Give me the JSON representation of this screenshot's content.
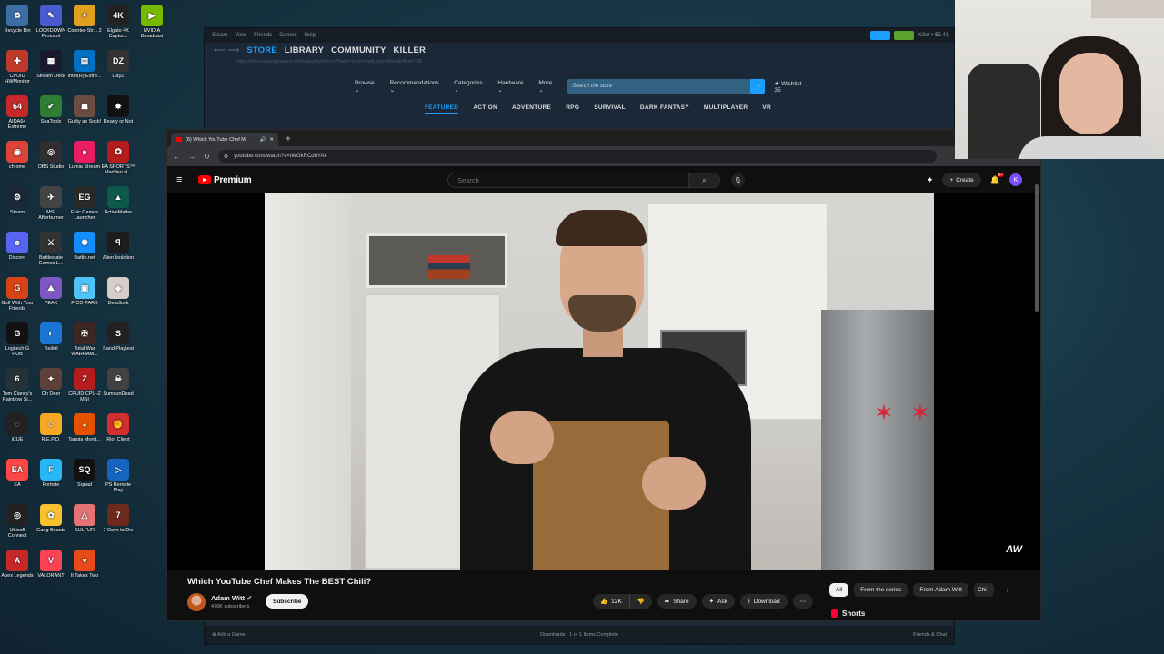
{
  "desktop": {
    "icons": [
      {
        "label": "Recycle Bin",
        "icon": "recycle-bin-icon",
        "color": "#3b6ea5",
        "glyph": "♻"
      },
      {
        "label": "LOCKDOWN Protocol",
        "icon": "lockdown-protocol-icon",
        "color": "#4a5bd0",
        "glyph": "✎"
      },
      {
        "label": "Counter-Str... 2",
        "icon": "counter-strike-icon",
        "color": "#e0a020",
        "glyph": "✦"
      },
      {
        "label": "Elgato 4K Captur...",
        "icon": "elgato-icon",
        "color": "#222",
        "glyph": "4K"
      },
      {
        "label": "NVIDIA Broadcast",
        "icon": "nvidia-broadcast-icon",
        "color": "#76b900",
        "glyph": "▶"
      },
      {
        "label": "CPUID HWMonitor",
        "icon": "hwmonitor-icon",
        "color": "#c0392b",
        "glyph": "✚"
      },
      {
        "label": "Stream Deck",
        "icon": "stream-deck-icon",
        "color": "#1a1a2e",
        "glyph": "▦"
      },
      {
        "label": "Intel(R) Extre...",
        "icon": "intel-xtu-icon",
        "color": "#0071c5",
        "glyph": "▤"
      },
      {
        "label": "DayZ",
        "icon": "dayz-icon",
        "color": "#333",
        "glyph": "DZ"
      },
      {
        "label": "AIDA64 Extreme",
        "icon": "aida64-icon",
        "color": "#c62828",
        "glyph": "64"
      },
      {
        "label": "SeaTools",
        "icon": "seatools-icon",
        "color": "#2e7d32",
        "glyph": "✔"
      },
      {
        "label": "Guilty as Sock!",
        "icon": "guilty-as-sock-icon",
        "color": "#6d4c41",
        "glyph": "☗"
      },
      {
        "label": "Ready or Not",
        "icon": "ready-or-not-icon",
        "color": "#111",
        "glyph": "✸"
      },
      {
        "label": "chrome",
        "icon": "chrome-icon",
        "color": "#db4437",
        "glyph": "◉"
      },
      {
        "label": "OBS Studio",
        "icon": "obs-icon",
        "color": "#302e31",
        "glyph": "◎"
      },
      {
        "label": "Lumia Stream",
        "icon": "lumia-stream-icon",
        "color": "#e91e63",
        "glyph": "●"
      },
      {
        "label": "EA SPORTS™ Madden N...",
        "icon": "madden-icon",
        "color": "#b71c1c",
        "glyph": "✪"
      },
      {
        "label": "Steam",
        "icon": "steam-icon",
        "color": "#1b2838",
        "glyph": "⚙"
      },
      {
        "label": "MSI Afterburner",
        "icon": "msi-afterburner-icon",
        "color": "#444",
        "glyph": "✈"
      },
      {
        "label": "Epic Games Launcher",
        "icon": "epic-games-icon",
        "color": "#2a2a2a",
        "glyph": "EG"
      },
      {
        "label": "ActiveMatter",
        "icon": "active-matter-icon",
        "color": "#0e5a4a",
        "glyph": "▲"
      },
      {
        "label": "Discord",
        "icon": "discord-icon",
        "color": "#5865f2",
        "glyph": "☻"
      },
      {
        "label": "Battlestate Games L...",
        "icon": "battlestate-icon",
        "color": "#333",
        "glyph": "⚔"
      },
      {
        "label": "Battle.net",
        "icon": "battlenet-icon",
        "color": "#148eff",
        "glyph": "✺"
      },
      {
        "label": "Alien Isolation",
        "icon": "alien-isolation-icon",
        "color": "#1c1c1c",
        "glyph": "ꟼ"
      },
      {
        "label": "Golf With Your Friends",
        "icon": "golf-with-friends-icon",
        "color": "#d84315",
        "glyph": "G"
      },
      {
        "label": "PEAK",
        "icon": "peak-icon",
        "color": "#7e57c2",
        "glyph": "⛰"
      },
      {
        "label": "PICO PARK",
        "icon": "pico-park-icon",
        "color": "#4fc3f7",
        "glyph": "▣"
      },
      {
        "label": "Deadlock",
        "icon": "deadlock-icon",
        "color": "#d7ccc8",
        "glyph": "◈"
      },
      {
        "label": "Logitech G HUB",
        "icon": "logitech-ghub-icon",
        "color": "#111",
        "glyph": "G"
      },
      {
        "label": "Toolkit",
        "icon": "toolkit-icon",
        "color": "#1976d2",
        "glyph": "◐"
      },
      {
        "label": "Total War WARHAM...",
        "icon": "total-war-icon",
        "color": "#3e2723",
        "glyph": "✠"
      },
      {
        "label": "Sand Playtest",
        "icon": "sand-playtest-icon",
        "color": "#222",
        "glyph": "S"
      },
      {
        "label": "Tom Clancy's Rainbow Si...",
        "icon": "rainbow-six-icon",
        "color": "#263238",
        "glyph": "6"
      },
      {
        "label": "Oh Deer",
        "icon": "oh-deer-icon",
        "color": "#5d4037",
        "glyph": "✦"
      },
      {
        "label": "CPUID CPU-Z MSI",
        "icon": "cpu-z-icon",
        "color": "#b71c1c",
        "glyph": "Z"
      },
      {
        "label": "SumsunDead",
        "icon": "sumsundead-icon",
        "color": "#424242",
        "glyph": "☠"
      },
      {
        "label": "iCUE",
        "icon": "icue-icon",
        "color": "#222",
        "glyph": "◌"
      },
      {
        "label": "R.E.P.O.",
        "icon": "repo-icon",
        "color": "#f9a825",
        "glyph": "☺"
      },
      {
        "label": "Tangia Monit...",
        "icon": "tangia-icon",
        "color": "#e65100",
        "glyph": "◕"
      },
      {
        "label": "Riot Client",
        "icon": "riot-client-icon",
        "color": "#d32f2f",
        "glyph": "✊"
      },
      {
        "label": "EA",
        "icon": "ea-icon",
        "color": "#ff4747",
        "glyph": "EA"
      },
      {
        "label": "Fortnite",
        "icon": "fortnite-icon",
        "color": "#29b6f6",
        "glyph": "F"
      },
      {
        "label": "Squad",
        "icon": "squad-icon",
        "color": "#111",
        "glyph": "SQ"
      },
      {
        "label": "PS Remote Play",
        "icon": "ps-remote-play-icon",
        "color": "#1565c0",
        "glyph": "▷"
      },
      {
        "label": "Ubisoft Connect",
        "icon": "ubisoft-connect-icon",
        "color": "#222",
        "glyph": "◎"
      },
      {
        "label": "Gang Beasts",
        "icon": "gang-beasts-icon",
        "color": "#fbc02d",
        "glyph": "✿"
      },
      {
        "label": "SULFUR",
        "icon": "sulfur-icon",
        "color": "#e57373",
        "glyph": "△"
      },
      {
        "label": "7 Days to Die",
        "icon": "7-days-to-die-icon",
        "color": "#6d2a1a",
        "glyph": "7"
      },
      {
        "label": "Apex Legends",
        "icon": "apex-legends-icon",
        "color": "#c62828",
        "glyph": "A"
      },
      {
        "label": "VALORANT",
        "icon": "valorant-icon",
        "color": "#fa4454",
        "glyph": "V"
      },
      {
        "label": "It Takes Two",
        "icon": "it-takes-two-icon",
        "color": "#e64a19",
        "glyph": "♥"
      }
    ]
  },
  "steam": {
    "menu": [
      "Steam",
      "View",
      "Friends",
      "Games",
      "Help"
    ],
    "status_text": "Killer • $5.41",
    "nav": [
      "STORE",
      "LIBRARY",
      "COMMUNITY",
      "KILLER"
    ],
    "url": "https://store.steampowered.com/category/horror/?flavor=contenthub_toprsellers&offset=108",
    "storebar": [
      "Browse ⌄",
      "Recommendations ⌄",
      "Categories ⌄",
      "Hardware ⌄",
      "More ⌄"
    ],
    "search_placeholder": "Search the store",
    "wishlist": "Wishlist 35",
    "categories": [
      "FEATURED",
      "ACTION",
      "ADVENTURE",
      "RPG",
      "SURVIVAL",
      "DARK FANTASY",
      "MULTIPLAYER",
      "VR"
    ],
    "footer_left": "Add a Game",
    "footer_center": "Downloads - 1 of 1 Items Complete",
    "footer_right": "Friends & Chat"
  },
  "browser": {
    "tab_title": "(6) Which YouTube Chef M",
    "url": "youtube.com/watch?v=tWGkRCdhYAk"
  },
  "youtube": {
    "logo_text": "Premium",
    "search_placeholder": "Search",
    "create_label": "Create",
    "notification_count": "9+",
    "avatar_letter": "K",
    "video_title": "Which YouTube Chef Makes The BEST Chili?",
    "channel_name": "Adam Witt",
    "channel_subs": "476K subscribers",
    "subscribe_label": "Subscribe",
    "like_count": "12K",
    "share_label": "Share",
    "ask_label": "Ask",
    "download_label": "Download",
    "more_label": "⋯",
    "watermark": "AW",
    "chips": [
      "All",
      "From the series",
      "From Adam Witt",
      "Chi"
    ],
    "shorts_label": "Shorts"
  }
}
